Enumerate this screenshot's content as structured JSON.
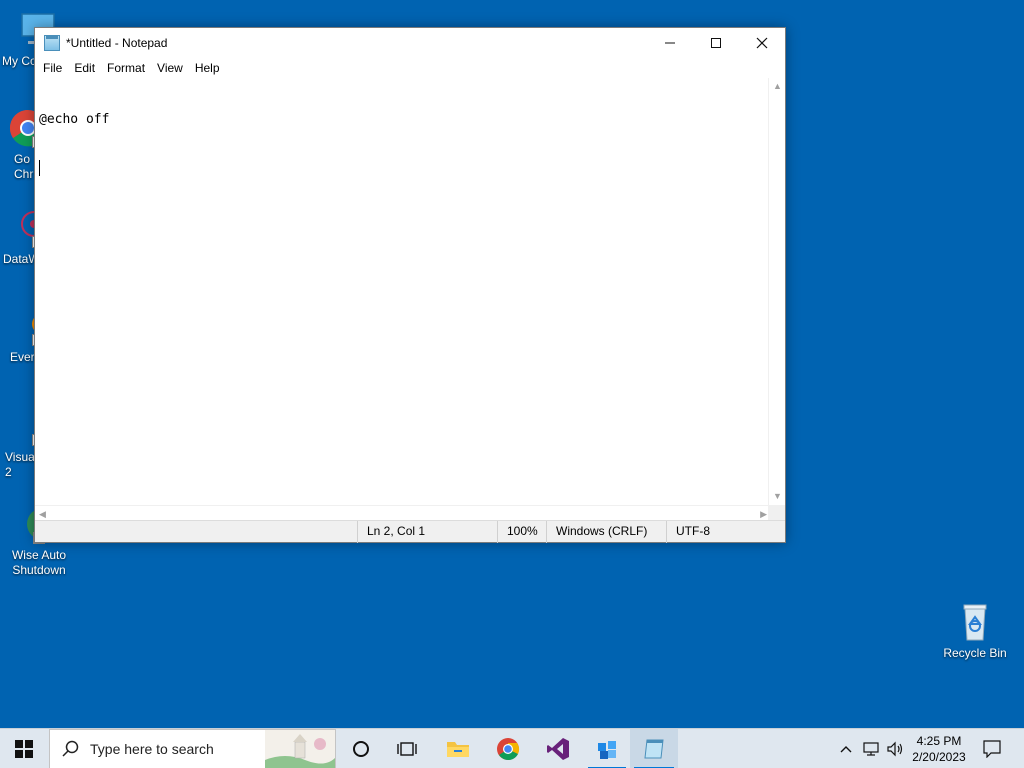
{
  "desktop": {
    "icons": [
      {
        "label": "My Co",
        "name": "desktop-icon-my-computer"
      },
      {
        "label": "Go\nChr",
        "name": "desktop-icon-google-chrome"
      },
      {
        "label": "DataW",
        "name": "desktop-icon-datawrapper"
      },
      {
        "label": "Ever",
        "name": "desktop-icon-everything"
      },
      {
        "label": "Visua\n2",
        "name": "desktop-icon-visual-studio"
      },
      {
        "label": "Wise Auto\nShutdown",
        "name": "desktop-icon-wise-auto-shutdown"
      }
    ],
    "recycle_bin": {
      "label": "Recycle Bin"
    }
  },
  "notepad": {
    "title": "*Untitled - Notepad",
    "menu": [
      "File",
      "Edit",
      "Format",
      "View",
      "Help"
    ],
    "content": "@echo off",
    "status": {
      "position": "Ln 2, Col 1",
      "zoom": "100%",
      "line_ending": "Windows (CRLF)",
      "encoding": "UTF-8"
    }
  },
  "taskbar": {
    "search_placeholder": "Type here to search",
    "clock_time": "4:25 PM",
    "clock_date": "2/20/2023"
  },
  "colors": {
    "desktop_bg": "#0063b1",
    "taskbar_bg": "#dfe7ef",
    "accent": "#0078d7"
  }
}
